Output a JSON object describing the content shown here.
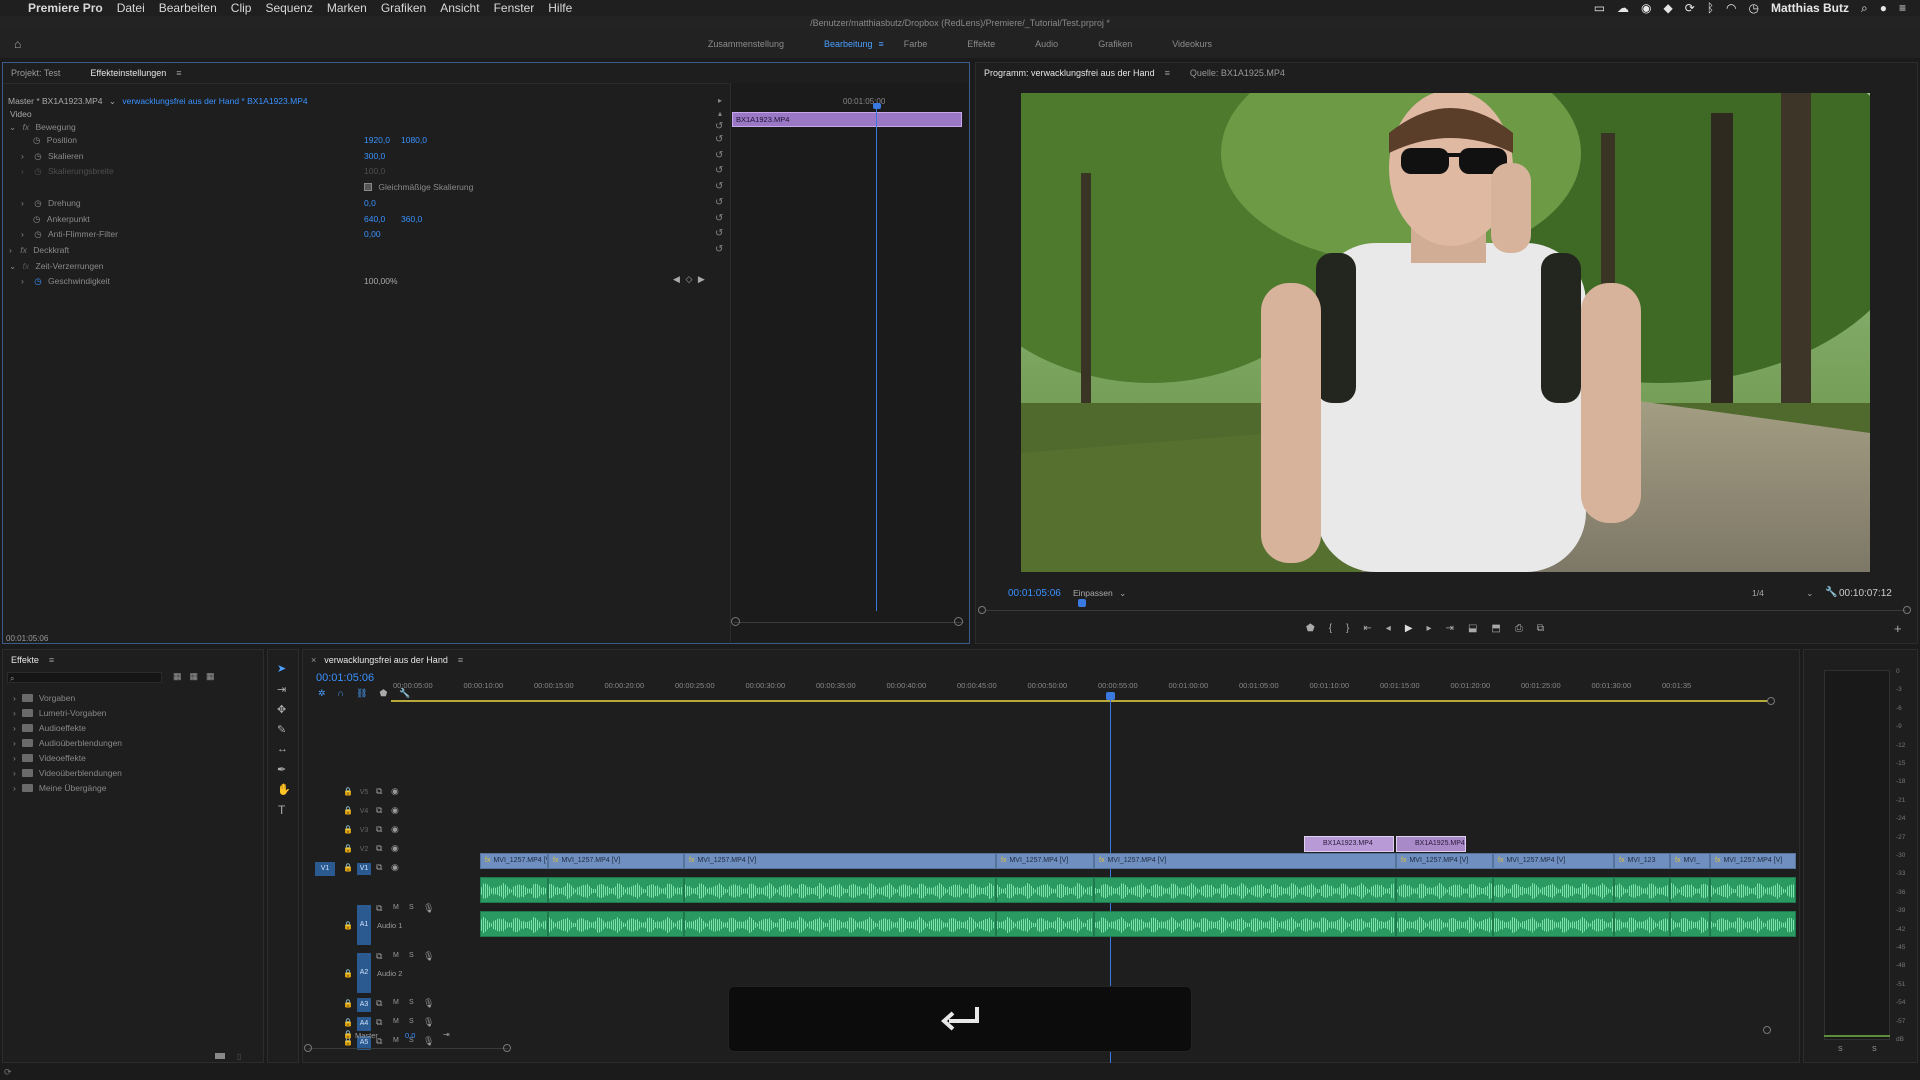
{
  "menubar": {
    "app": "Premiere Pro",
    "items": [
      "Datei",
      "Bearbeiten",
      "Clip",
      "Sequenz",
      "Marken",
      "Grafiken",
      "Ansicht",
      "Fenster",
      "Hilfe"
    ],
    "user": "Matthias Butz"
  },
  "titlebar": {
    "path": "/Benutzer/matthiasbutz/Dropbox (RedLens)/Premiere/_Tutorial/Test.prproj *"
  },
  "workspaces": {
    "items": [
      "Zusammenstellung",
      "Bearbeitung",
      "Farbe",
      "Effekte",
      "Audio",
      "Grafiken",
      "Videokurs"
    ],
    "active": "Bearbeitung"
  },
  "effect_panel": {
    "tab_project": "Projekt: Test",
    "tab_effects": "Effekteinstellungen",
    "master": "Master * BX1A1923.MP4",
    "seq": "verwacklungsfrei aus der Hand * BX1A1923.MP4",
    "section_video": "Video",
    "rows": {
      "motion": "Bewegung",
      "position": "Position",
      "pos_x": "1920,0",
      "pos_y": "1080,0",
      "scale": "Skalieren",
      "scale_val": "300,0",
      "scale_width": "Skalierungsbreite",
      "scale_width_val": "100,0",
      "uniform": "Gleichmäßige Skalierung",
      "rotation": "Drehung",
      "rotation_val": "0,0",
      "anchor": "Ankerpunkt",
      "anchor_x": "640,0",
      "anchor_y": "360,0",
      "antiflicker": "Anti-Flimmer-Filter",
      "antiflicker_val": "0,00",
      "opacity": "Deckkraft",
      "time_remap": "Zeit-Verzerrungen",
      "speed": "Geschwindigkeit",
      "speed_val": "100,00%"
    },
    "mini_time": "00:01:05:00",
    "mini_clip": "BX1A1923.MP4",
    "footer_time": "00:01:05:06"
  },
  "program": {
    "tab": "Programm: verwacklungsfrei aus der Hand",
    "tab_source": "Quelle: BX1A1925.MP4",
    "timecode": "00:01:05:06",
    "fit": "Einpassen",
    "resolution": "1/4",
    "duration": "00:10:07:12"
  },
  "effects_browser": {
    "tab": "Effekte",
    "items": [
      "Vorgaben",
      "Lumetri-Vorgaben",
      "Audioeffekte",
      "Audioüberblendungen",
      "Videoeffekte",
      "Videoüberblendungen",
      "Meine Übergänge"
    ]
  },
  "timeline": {
    "tab": "verwacklungsfrei aus der Hand",
    "timecode": "00:01:05:06",
    "ruler": [
      "00:00:05:00",
      "00:00:10:00",
      "00:00:15:00",
      "00:00:20:00",
      "00:00:25:00",
      "00:00:30:00",
      "00:00:35:00",
      "00:00:40:00",
      "00:00:45:00",
      "00:00:50:00",
      "00:00:55:00",
      "00:01:00:00",
      "00:01:05:00",
      "00:01:10:00",
      "00:01:15:00",
      "00:01:20:00",
      "00:01:25:00",
      "00:01:30:00",
      "00:01:35"
    ],
    "video_tracks": [
      "V5",
      "V4",
      "V3",
      "V2",
      "V1"
    ],
    "audio_tracks": [
      "A1",
      "A2",
      "A3",
      "A4",
      "A5"
    ],
    "audio_names": [
      "Audio 1",
      "Audio 2"
    ],
    "master_label": "Master",
    "master_val": "0,0",
    "v1_clips": [
      "MVI_1257.MP4 [V]",
      "MVI_1257.MP4 [V]",
      "MVI_1257.MP4 [V]",
      "MVI_1257.MP4 [V]",
      "MVI_1257.MP4 [V]",
      "MVI_1257.MP4 [V]",
      "MVI_1257.MP4 [V]",
      "MVI_123",
      "MVI_",
      "MVI_1257.MP4 [V]"
    ],
    "v2_clips": [
      "BX1A1923.MP4",
      "BX1A1925.MP4"
    ],
    "mute": "M",
    "solo": "S"
  },
  "meter": {
    "labels": [
      "0",
      "-3",
      "-6",
      "-9",
      "-12",
      "-15",
      "-18",
      "-21",
      "-24",
      "-27",
      "-30",
      "-33",
      "-36",
      "-39",
      "-42",
      "-45",
      "-48",
      "-51",
      "-54",
      "-57",
      "dB"
    ],
    "footer": [
      "S",
      "S"
    ]
  },
  "overlay": {
    "icon": "return-arrow"
  }
}
